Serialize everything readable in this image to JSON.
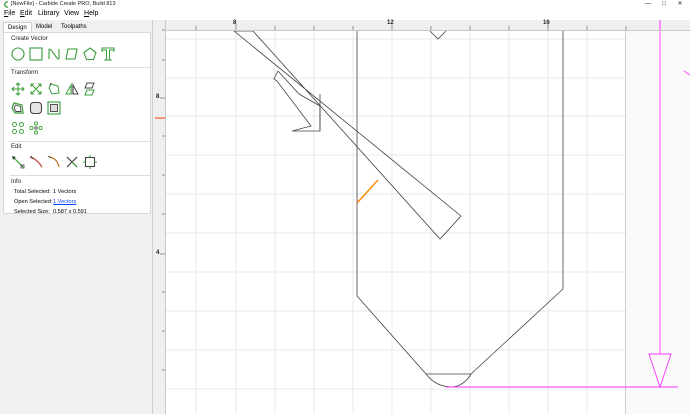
{
  "window": {
    "title": "[NewFile] - Carbide Create PRO, Build 813",
    "controls": {
      "minimize": "—",
      "maximize": "□",
      "close": "✕"
    }
  },
  "menubar": [
    {
      "label": "File",
      "key": "F",
      "rest": "ile"
    },
    {
      "label": "Edit",
      "key": "E",
      "rest": "dit"
    },
    {
      "label": "Library",
      "key": "",
      "rest": "Library"
    },
    {
      "label": "View",
      "key": "",
      "rest": "View"
    },
    {
      "label": "Help",
      "key": "H",
      "rest": "elp"
    }
  ],
  "tabs": [
    "Design",
    "Model",
    "Toolpaths"
  ],
  "active_tab": "Design",
  "sections": {
    "create_vector": "Create Vector",
    "transform": "Transform",
    "edit": "Edit",
    "info": "Info"
  },
  "info": {
    "total_selected_label": "Total Selected:",
    "total_selected_value": "1 Vectors",
    "open_selected_label": "Open Selected:",
    "open_selected_value": "1 Vectors",
    "selected_size_label": "Selected Size:",
    "selected_size_value": "0.587 x 0.591"
  },
  "rulers": {
    "horizontal": [
      "8",
      "12",
      "16"
    ],
    "vertical": [
      "8",
      "4"
    ]
  },
  "icons": {
    "create_vector": [
      "circle-icon",
      "rectangle-icon",
      "curve-icon",
      "polygon-icon",
      "pentagon-icon",
      "text-icon"
    ],
    "transform_row1": [
      "move-icon",
      "scale-icon",
      "rotate-icon",
      "mirror-icon",
      "align-icon"
    ],
    "transform_row2": [
      "offset-icon",
      "fillet-icon",
      "box-select-icon"
    ],
    "transform_row3": [
      "array-icon",
      "circular-array-icon"
    ],
    "edit": [
      "node-edit-icon",
      "trim-icon",
      "arc-edit-icon",
      "cut-icon",
      "join-icon"
    ]
  },
  "colors": {
    "accent_green": "#3a9c3a",
    "selection_orange": "#ff8800",
    "guide_magenta": "#ff33ff",
    "link_blue": "#0645ff"
  }
}
